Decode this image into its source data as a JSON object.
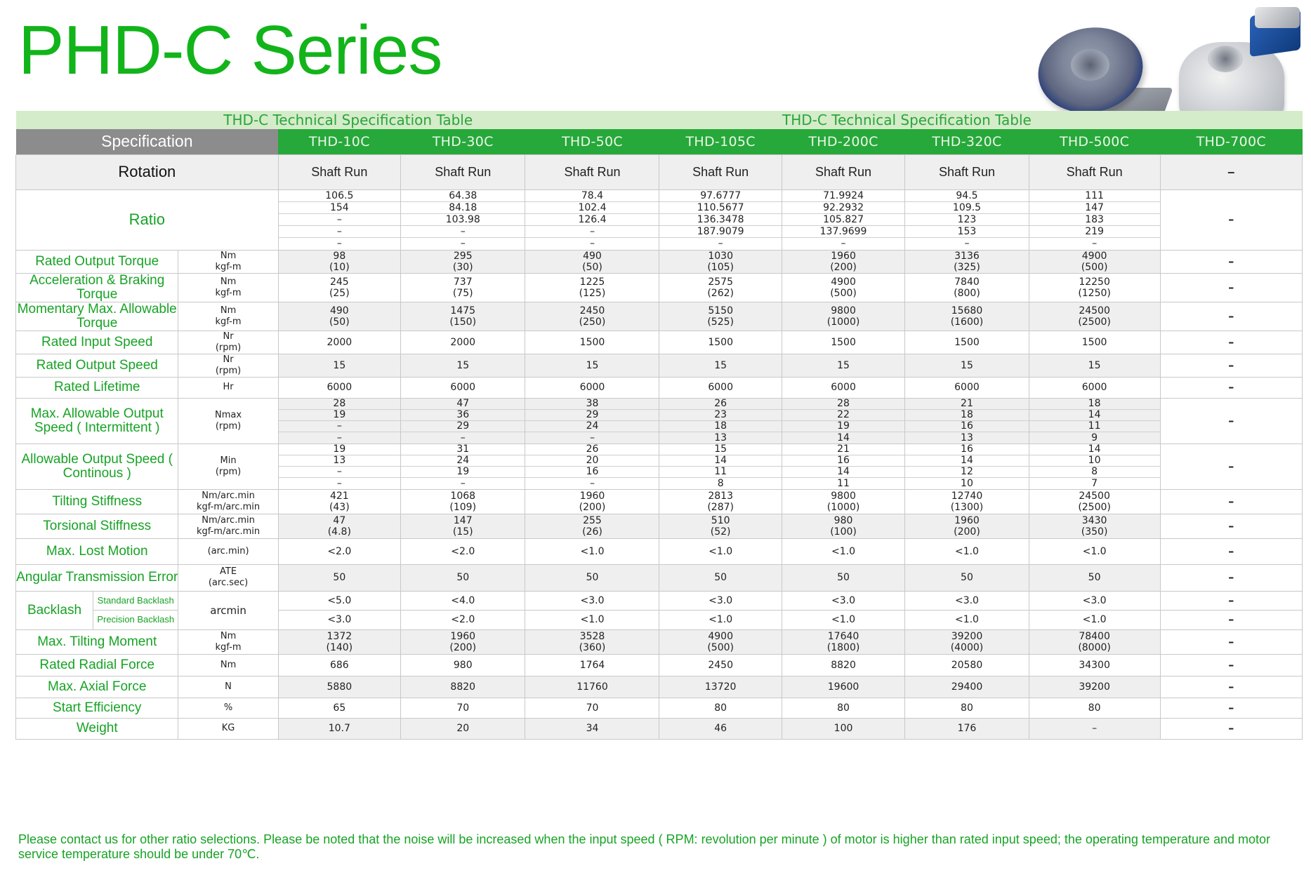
{
  "title": "PHD-C Series",
  "banner": {
    "left": "THD-C Technical Specification Table",
    "right": "THD-C Technical Specification Table"
  },
  "spec_header": "Specification",
  "models": [
    "THD-10C",
    "THD-30C",
    "THD-50C",
    "THD-105C",
    "THD-200C",
    "THD-320C",
    "THD-500C",
    "THD-700C"
  ],
  "rotation": {
    "label": "Rotation",
    "values": [
      "Shaft Run",
      "Shaft Run",
      "Shaft Run",
      "Shaft Run",
      "Shaft Run",
      "Shaft Run",
      "Shaft Run",
      "–"
    ]
  },
  "ratio": {
    "label": "Ratio",
    "columns": [
      [
        "106.5",
        "154",
        "–",
        "–",
        "–"
      ],
      [
        "64.38",
        "84.18",
        "103.98",
        "–",
        "–"
      ],
      [
        "78.4",
        "102.4",
        "126.4",
        "–",
        "–"
      ],
      [
        "97.6777",
        "110.5677",
        "136.3478",
        "187.9079",
        "–"
      ],
      [
        "71.9924",
        "92.2932",
        "105.827",
        "137.9699",
        "–"
      ],
      [
        "94.5",
        "109.5",
        "123",
        "153",
        "–"
      ],
      [
        "111",
        "147",
        "183",
        "219",
        "–"
      ]
    ],
    "thd700": "–"
  },
  "rows": [
    {
      "label": "Rated Output Torque",
      "unit": [
        "Nm",
        "kgf-m"
      ],
      "shade": true,
      "values": [
        [
          "98",
          "(10)"
        ],
        [
          "295",
          "(30)"
        ],
        [
          "490",
          "(50)"
        ],
        [
          "1030",
          "(105)"
        ],
        [
          "1960",
          "(200)"
        ],
        [
          "3136",
          "(325)"
        ],
        [
          "4900",
          "(500)"
        ],
        [
          "–"
        ]
      ]
    },
    {
      "label": "Acceleration & Braking Torque",
      "unit": [
        "Nm",
        "kgf-m"
      ],
      "shade": false,
      "values": [
        [
          "245",
          "(25)"
        ],
        [
          "737",
          "(75)"
        ],
        [
          "1225",
          "(125)"
        ],
        [
          "2575",
          "(262)"
        ],
        [
          "4900",
          "(500)"
        ],
        [
          "7840",
          "(800)"
        ],
        [
          "12250",
          "(1250)"
        ],
        [
          "–"
        ]
      ]
    },
    {
      "label": "Momentary Max. Allowable Torque",
      "unit": [
        "Nm",
        "kgf-m"
      ],
      "shade": true,
      "values": [
        [
          "490",
          "(50)"
        ],
        [
          "1475",
          "(150)"
        ],
        [
          "2450",
          "(250)"
        ],
        [
          "5150",
          "(525)"
        ],
        [
          "9800",
          "(1000)"
        ],
        [
          "15680",
          "(1600)"
        ],
        [
          "24500",
          "(2500)"
        ],
        [
          "–"
        ]
      ]
    },
    {
      "label": "Rated Input Speed",
      "unit": [
        "Nr",
        "(rpm)"
      ],
      "shade": false,
      "values": [
        [
          "2000"
        ],
        [
          "2000"
        ],
        [
          "1500"
        ],
        [
          "1500"
        ],
        [
          "1500"
        ],
        [
          "1500"
        ],
        [
          "1500"
        ],
        [
          "–"
        ]
      ]
    },
    {
      "label": "Rated Output Speed",
      "unit": [
        "Nr",
        "(rpm)"
      ],
      "shade": true,
      "values": [
        [
          "15"
        ],
        [
          "15"
        ],
        [
          "15"
        ],
        [
          "15"
        ],
        [
          "15"
        ],
        [
          "15"
        ],
        [
          "15"
        ],
        [
          "–"
        ]
      ]
    },
    {
      "label": "Rated Lifetime",
      "unit": [
        "Hr"
      ],
      "shade": false,
      "values": [
        [
          "6000"
        ],
        [
          "6000"
        ],
        [
          "6000"
        ],
        [
          "6000"
        ],
        [
          "6000"
        ],
        [
          "6000"
        ],
        [
          "6000"
        ],
        [
          "–"
        ]
      ]
    }
  ],
  "max_output_speed": {
    "label": "Max. Allowable Output Speed ( Intermittent )",
    "unit": [
      "Nmax",
      "(rpm)"
    ],
    "columns": [
      [
        "28",
        "19",
        "–",
        "–"
      ],
      [
        "47",
        "36",
        "29",
        "–"
      ],
      [
        "38",
        "29",
        "24",
        "–"
      ],
      [
        "26",
        "23",
        "18",
        "13"
      ],
      [
        "28",
        "22",
        "19",
        "14"
      ],
      [
        "21",
        "18",
        "16",
        "13"
      ],
      [
        "18",
        "14",
        "11",
        "9"
      ]
    ],
    "thd700": "–"
  },
  "cont_output_speed": {
    "label": "Allowable Output Speed ( Continous )",
    "unit": [
      "Min",
      "(rpm)"
    ],
    "columns": [
      [
        "19",
        "13",
        "–",
        "–"
      ],
      [
        "31",
        "24",
        "19",
        "–"
      ],
      [
        "26",
        "20",
        "16",
        "–"
      ],
      [
        "15",
        "14",
        "11",
        "8"
      ],
      [
        "21",
        "16",
        "14",
        "11"
      ],
      [
        "16",
        "14",
        "12",
        "10"
      ],
      [
        "14",
        "10",
        "8",
        "7"
      ]
    ],
    "thd700": "–"
  },
  "rows2": [
    {
      "label": "Tilting Stiffness",
      "unit": [
        "Nm/arc.min",
        "kgf-m/arc.min"
      ],
      "shade": false,
      "values": [
        [
          "421",
          "(43)"
        ],
        [
          "1068",
          "(109)"
        ],
        [
          "1960",
          "(200)"
        ],
        [
          "2813",
          "(287)"
        ],
        [
          "9800",
          "(1000)"
        ],
        [
          "12740",
          "(1300)"
        ],
        [
          "24500",
          "(2500)"
        ],
        [
          "–"
        ]
      ]
    },
    {
      "label": "Torsional Stiffness",
      "unit": [
        "Nm/arc.min",
        "kgf-m/arc.min"
      ],
      "shade": true,
      "values": [
        [
          "47",
          "(4.8)"
        ],
        [
          "147",
          "(15)"
        ],
        [
          "255",
          "(26)"
        ],
        [
          "510",
          "(52)"
        ],
        [
          "980",
          "(100)"
        ],
        [
          "1960",
          "(200)"
        ],
        [
          "3430",
          "(350)"
        ],
        [
          "–"
        ]
      ]
    },
    {
      "label": "Max. Lost Motion",
      "unit": [
        "(arc.min)"
      ],
      "shade": false,
      "values": [
        [
          "<2.0"
        ],
        [
          "<2.0"
        ],
        [
          "<1.0"
        ],
        [
          "<1.0"
        ],
        [
          "<1.0"
        ],
        [
          "<1.0"
        ],
        [
          "<1.0"
        ],
        [
          "–"
        ]
      ]
    },
    {
      "label": "Angular Transmission Error",
      "unit": [
        "ATE",
        "(arc.sec)"
      ],
      "shade": true,
      "values": [
        [
          "50"
        ],
        [
          "50"
        ],
        [
          "50"
        ],
        [
          "50"
        ],
        [
          "50"
        ],
        [
          "50"
        ],
        [
          "50"
        ],
        [
          "–"
        ]
      ]
    }
  ],
  "backlash": {
    "label": "Backlash",
    "unit": "arcmin",
    "sub": [
      {
        "label": "Standard Backlash",
        "values": [
          "<5.0",
          "<4.0",
          "<3.0",
          "<3.0",
          "<3.0",
          "<3.0",
          "<3.0",
          "–"
        ]
      },
      {
        "label": "Precision Backlash",
        "values": [
          "<3.0",
          "<2.0",
          "<1.0",
          "<1.0",
          "<1.0",
          "<1.0",
          "<1.0",
          "–"
        ]
      }
    ]
  },
  "rows3": [
    {
      "label": "Max. Tilting Moment",
      "unit": [
        "Nm",
        "kgf-m"
      ],
      "shade": true,
      "values": [
        [
          "1372",
          "(140)"
        ],
        [
          "1960",
          "(200)"
        ],
        [
          "3528",
          "(360)"
        ],
        [
          "4900",
          "(500)"
        ],
        [
          "17640",
          "(1800)"
        ],
        [
          "39200",
          "(4000)"
        ],
        [
          "78400",
          "(8000)"
        ],
        [
          "–"
        ]
      ]
    },
    {
      "label": "Rated Radial Force",
      "unit": [
        "Nm"
      ],
      "shade": false,
      "values": [
        [
          "686"
        ],
        [
          "980"
        ],
        [
          "1764"
        ],
        [
          "2450"
        ],
        [
          "8820"
        ],
        [
          "20580"
        ],
        [
          "34300"
        ],
        [
          "–"
        ]
      ]
    },
    {
      "label": "Max. Axial Force",
      "unit": [
        "N"
      ],
      "shade": true,
      "values": [
        [
          "5880"
        ],
        [
          "8820"
        ],
        [
          "11760"
        ],
        [
          "13720"
        ],
        [
          "19600"
        ],
        [
          "29400"
        ],
        [
          "39200"
        ],
        [
          "–"
        ]
      ]
    },
    {
      "label": "Start Efficiency",
      "unit": [
        "%"
      ],
      "shade": false,
      "values": [
        [
          "65"
        ],
        [
          "70"
        ],
        [
          "70"
        ],
        [
          "80"
        ],
        [
          "80"
        ],
        [
          "80"
        ],
        [
          "80"
        ],
        [
          "–"
        ]
      ]
    },
    {
      "label": "Weight",
      "unit": [
        "KG"
      ],
      "shade": true,
      "values": [
        [
          "10.7"
        ],
        [
          "20"
        ],
        [
          "34"
        ],
        [
          "46"
        ],
        [
          "100"
        ],
        [
          "176"
        ],
        [
          "–"
        ],
        [
          "–"
        ]
      ]
    }
  ],
  "footnote": "Please contact us for other ratio selections. Please be noted that the noise will be increased when the input speed ( RPM: revolution per minute ) of motor is higher than rated input speed; the operating temperature and motor service temperature should be under 70℃."
}
